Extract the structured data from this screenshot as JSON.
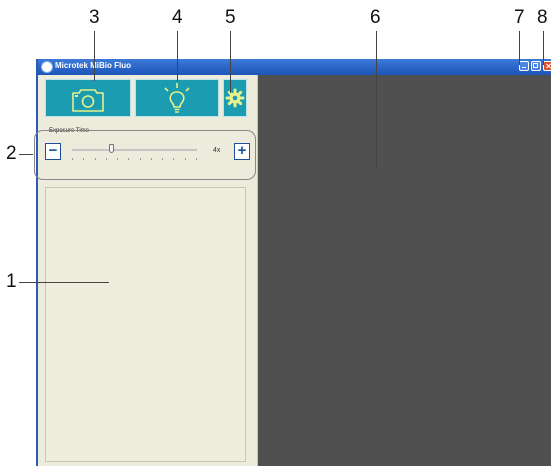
{
  "window": {
    "title": "Microtek MiBio Fluo",
    "icons": {
      "app": "microtek-logo-icon",
      "minimize": "minimize-icon",
      "maximize": "maximize-icon",
      "close": "close-icon"
    }
  },
  "toolbar": {
    "capture": {
      "icon": "camera-icon"
    },
    "light": {
      "icon": "light-bulb-icon"
    },
    "settings": {
      "icon": "gear-icon"
    }
  },
  "exposure": {
    "label": "Exposure Time",
    "value": "4x",
    "level_fraction": 0.31,
    "tick_count": 12,
    "decrease_icon": "minus-icon",
    "increase_icon": "plus-icon"
  },
  "callouts": [
    "1",
    "2",
    "3",
    "4",
    "5",
    "6",
    "7",
    "8"
  ],
  "colors": {
    "titlebar": "#2a62c8",
    "tool_button": "#1b9cb0",
    "icon_stroke": "#e8f08a",
    "panel": "#ecebdc",
    "preview": "#505050",
    "step_button": "#1f4e9c"
  }
}
